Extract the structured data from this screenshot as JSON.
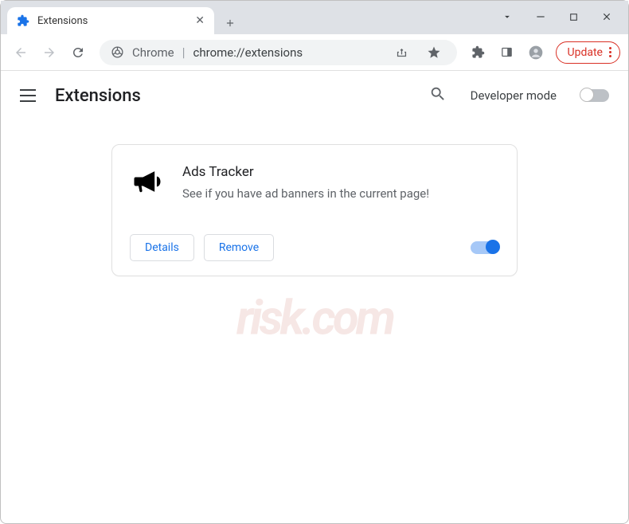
{
  "tab": {
    "title": "Extensions"
  },
  "omnibox": {
    "scheme_label": "Chrome",
    "url": "chrome://extensions"
  },
  "toolbar": {
    "update_label": "Update"
  },
  "page": {
    "title": "Extensions",
    "developer_mode_label": "Developer mode"
  },
  "extension": {
    "name": "Ads Tracker",
    "description": "See if you have ad banners in the current page!",
    "details_label": "Details",
    "remove_label": "Remove",
    "enabled": true
  }
}
